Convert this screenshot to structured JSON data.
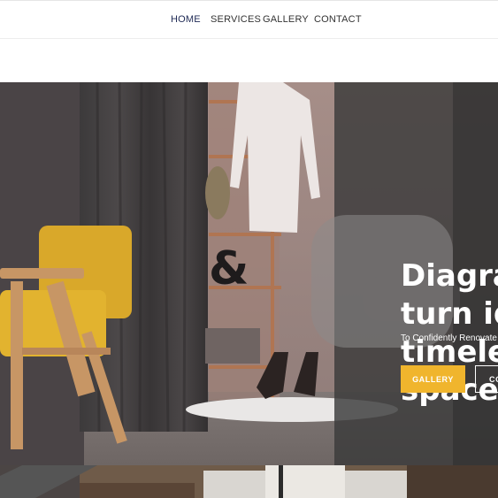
{
  "nav": {
    "items": [
      {
        "label": "HOME",
        "active": true
      },
      {
        "label": "SERVICES",
        "active": false
      },
      {
        "label": "GALLERY",
        "active": false
      },
      {
        "label": "CONTACT",
        "active": false
      }
    ]
  },
  "hero": {
    "title_lines": [
      "Diagra",
      "turn id",
      "timele",
      "space"
    ],
    "subtitle": "To Confidently Renovate",
    "buttons": {
      "primary": "GALLERY",
      "secondary": "CO"
    }
  },
  "colors": {
    "nav_active": "#1f2a55",
    "accent": "#f0b52d",
    "overlay": "#3a3a3a"
  },
  "icons": {
    "hero_background": "interior-photo-image"
  }
}
